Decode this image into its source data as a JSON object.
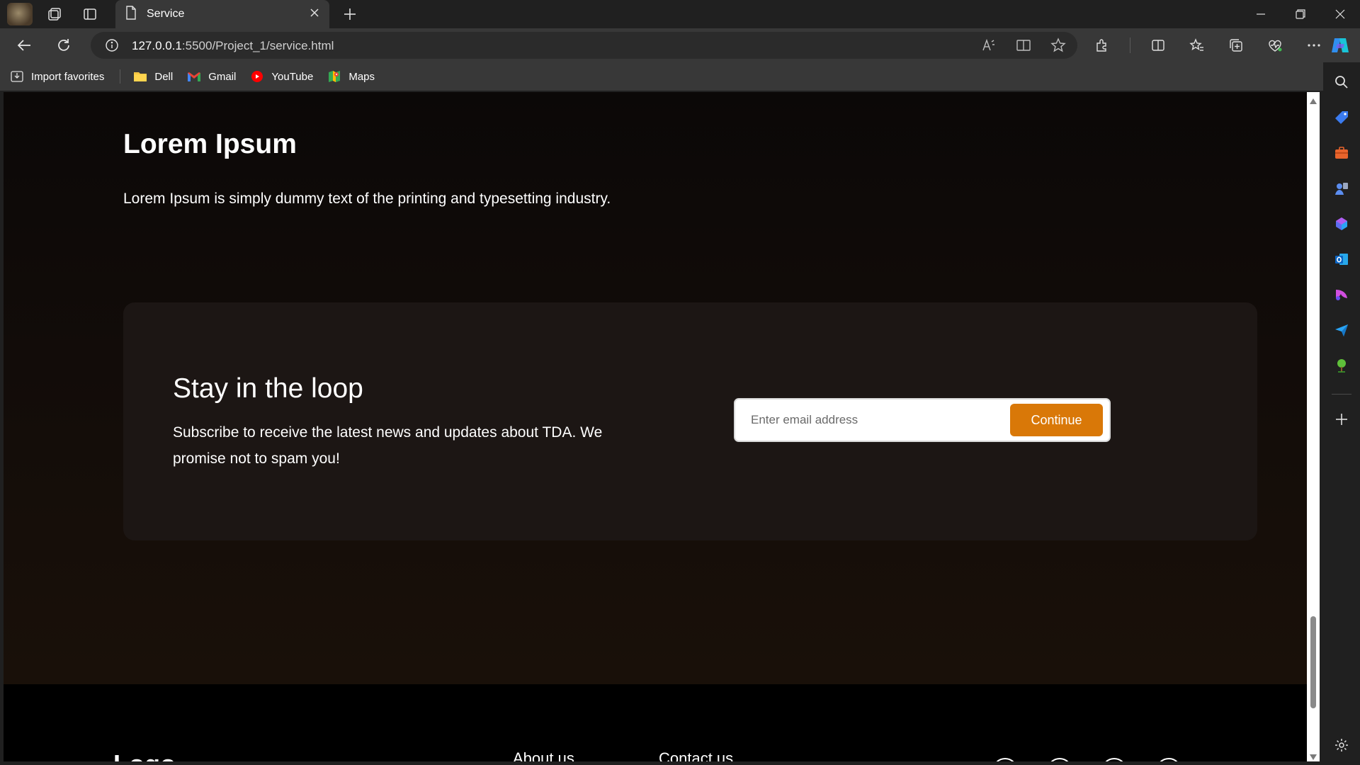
{
  "browser": {
    "tab_title": "Service",
    "url_host": "127.0.0.1",
    "url_rest": ":5500/Project_1/service.html",
    "favorites": [
      {
        "label": "Import favorites",
        "icon": "import-favorites-icon"
      },
      {
        "label": "Dell",
        "icon": "folder-icon"
      },
      {
        "label": "Gmail",
        "icon": "gmail-icon"
      },
      {
        "label": "YouTube",
        "icon": "youtube-icon"
      },
      {
        "label": "Maps",
        "icon": "maps-icon"
      }
    ]
  },
  "page": {
    "hero": {
      "title": "Lorem Ipsum",
      "text": "Lorem Ipsum is simply dummy text of the printing and typesetting industry."
    },
    "newsletter": {
      "title": "Stay in the loop",
      "text": "Subscribe to receive the latest news and updates about TDA. We promise not to spam you!",
      "email_placeholder": "Enter email address",
      "button_label": "Continue"
    },
    "footer": {
      "logo": "Logo",
      "about_label": "About us",
      "contact_label": "Contact us"
    }
  },
  "colors": {
    "accent": "#d97808",
    "card_bg": "#1c1614",
    "page_bg": "#0b0807"
  }
}
